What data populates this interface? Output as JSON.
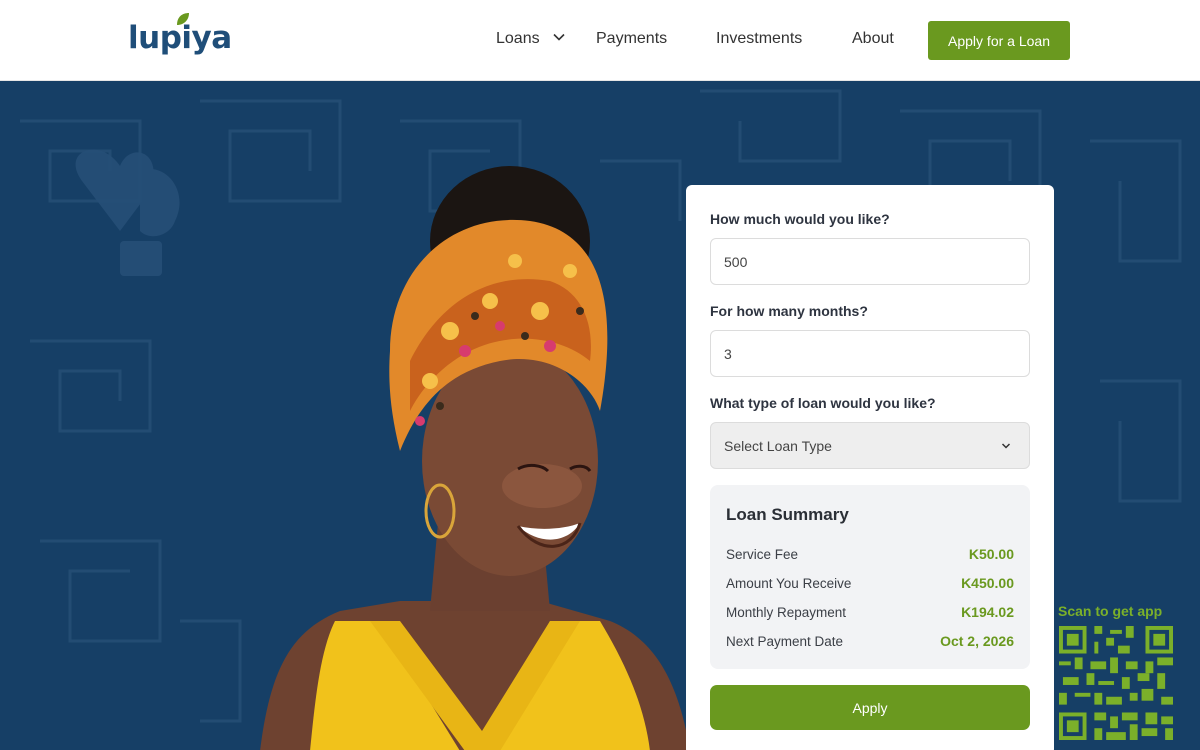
{
  "brand": {
    "logo_text": "lupiya",
    "accent_color": "#6a991f",
    "hero_color": "#163f66"
  },
  "nav": {
    "items": [
      {
        "label": "Loans",
        "has_dropdown": true
      },
      {
        "label": "Payments"
      },
      {
        "label": "Investments"
      },
      {
        "label": "About"
      }
    ],
    "cta_label": "Apply for a Loan"
  },
  "form": {
    "amount_question": "How much would you like?",
    "amount_value": "500",
    "months_question": "For how many months?",
    "months_value": "3",
    "type_question": "What type of loan would you like?",
    "type_selected": "Select Loan Type"
  },
  "summary": {
    "title": "Loan Summary",
    "rows": [
      {
        "label": "Service Fee",
        "value": "K50.00"
      },
      {
        "label": "Amount You Receive",
        "value": "K450.00"
      },
      {
        "label": "Monthly Repayment",
        "value": "K194.02"
      },
      {
        "label": "Next Payment Date",
        "value": "Oct 2, 2026"
      }
    ],
    "apply_label": "Apply"
  },
  "qr": {
    "label": "Scan to get app"
  },
  "icons": {
    "dropdown": "chevron-down-icon",
    "leaf": "leaf-icon",
    "qr": "qr-code"
  }
}
